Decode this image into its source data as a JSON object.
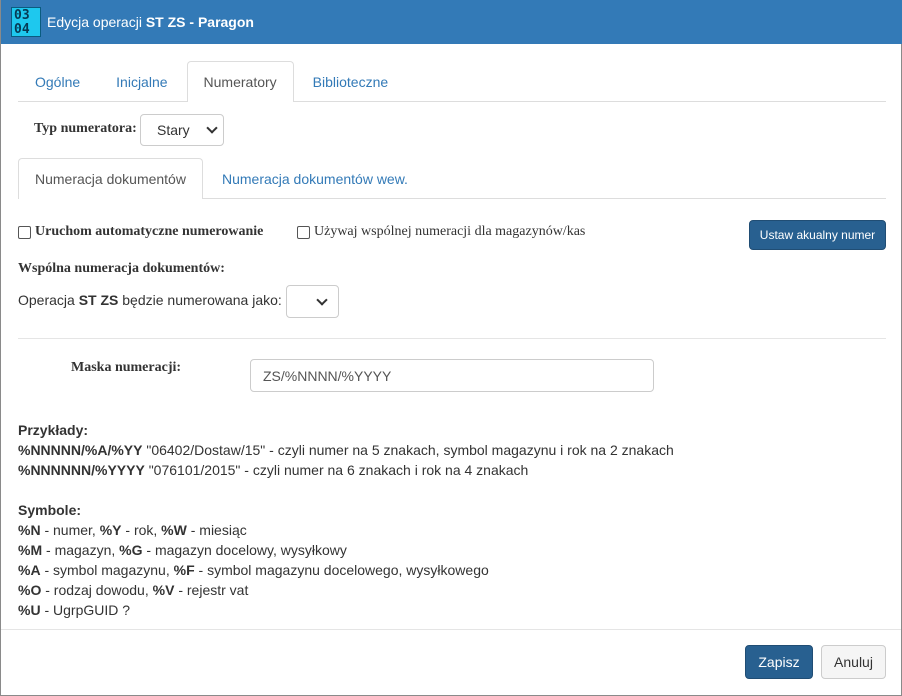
{
  "window": {
    "title_prefix": "Edycja operacji ",
    "title_bold": "ST ZS - Paragon",
    "icon_digits_top": "03",
    "icon_digits_bottom": "04"
  },
  "tabs_top": [
    "Ogólne",
    "Inicjalne",
    "Numeratory",
    "Biblioteczne"
  ],
  "tabs_top_active": "Numeratory",
  "numerator_type": {
    "label": "Typ numeratora:",
    "value": "Stary"
  },
  "tabs_sub": [
    "Numeracja dokumentów",
    "Numeracja dokumentów wew."
  ],
  "tabs_sub_active": "Numeracja dokumentów",
  "auto_numbering_label": "Uruchom automatyczne numerowanie",
  "shared_numbering_label": "Używaj wspólnej numeracji dla magazynów/kas",
  "set_number_button": "Ustaw akualny numer",
  "shared_section_title": "Wspólna numeracja dokumentów:",
  "operation_line": {
    "prefix": "Operacja ",
    "bold": "ST ZS",
    "suffix": " będzie numerowana jako:"
  },
  "operation_select_value": "",
  "mask": {
    "label": "Maska numeracji:",
    "value": "ZS/%NNNN/%YYYY"
  },
  "examples": {
    "title": "Przykłady:",
    "lines": [
      {
        "code": "%NNNNN/%A/%YY",
        "desc": " \"06402/Dostaw/15\" - czyli numer na 5 znakach, symbol magazynu i rok na 2 znakach"
      },
      {
        "code": "%NNNNNN/%YYYY",
        "desc": " \"076101/2015\" - czyli numer na 6 znakach i rok na 4 znakach"
      }
    ]
  },
  "symbols": {
    "title": "Symbole:",
    "lines": [
      [
        {
          "code": "%N",
          "desc": " - numer, "
        },
        {
          "code": "%Y",
          "desc": " - rok, "
        },
        {
          "code": "%W",
          "desc": " - miesiąc"
        }
      ],
      [
        {
          "code": "%M",
          "desc": " - magazyn, "
        },
        {
          "code": "%G",
          "desc": " - magazyn docelowy, wysyłkowy"
        }
      ],
      [
        {
          "code": "%A",
          "desc": " - symbol magazynu, "
        },
        {
          "code": "%F",
          "desc": " - symbol magazynu docelowego, wysyłkowego"
        }
      ],
      [
        {
          "code": "%O",
          "desc": " - rodzaj dowodu, "
        },
        {
          "code": "%V",
          "desc": " - rejestr vat"
        }
      ],
      [
        {
          "code": "%U",
          "desc": " - UgrpGUID ?"
        }
      ]
    ]
  },
  "footer": {
    "save": "Zapisz",
    "cancel": "Anuluj"
  },
  "colors": {
    "titlebar": "#337ab7",
    "primary": "#286090",
    "link": "#337ab7"
  }
}
